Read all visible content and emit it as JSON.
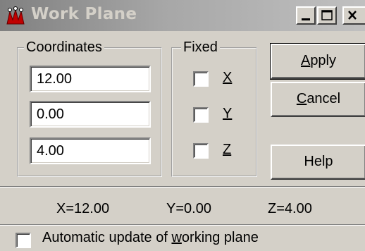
{
  "window": {
    "title": "Work Plane",
    "icon": "app-logo-icon",
    "controls": [
      "minimize-icon",
      "maximize-icon",
      "close-icon"
    ]
  },
  "coordinates": {
    "label": "Coordinates",
    "x_value": "12.00",
    "y_value": "0.00",
    "z_value": "4.00"
  },
  "fixed": {
    "label": "Fixed",
    "x": {
      "label": "X",
      "checked": false
    },
    "y": {
      "label": "Y",
      "checked": false
    },
    "z": {
      "label": "Z",
      "checked": false
    }
  },
  "buttons": {
    "apply": {
      "before": "",
      "mnemonic": "A",
      "after": "pply"
    },
    "cancel": {
      "before": "",
      "mnemonic": "C",
      "after": "ancel"
    },
    "help": "Help"
  },
  "status": {
    "x": "X=12.00",
    "y": "Y=0.00",
    "z": "Z=4.00"
  },
  "auto_update": {
    "before": "Automatic update of ",
    "mnemonic": "w",
    "after": "orking plane",
    "checked": false
  }
}
